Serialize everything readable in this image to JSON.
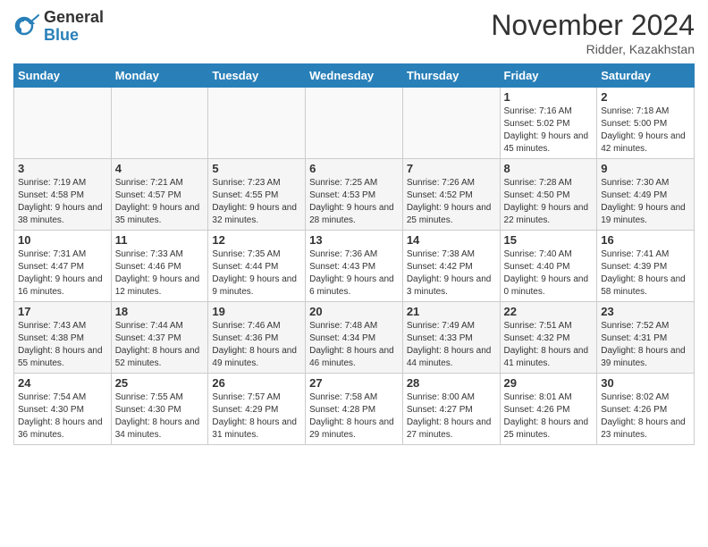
{
  "header": {
    "logo_general": "General",
    "logo_blue": "Blue",
    "title": "November 2024",
    "location": "Ridder, Kazakhstan"
  },
  "days_of_week": [
    "Sunday",
    "Monday",
    "Tuesday",
    "Wednesday",
    "Thursday",
    "Friday",
    "Saturday"
  ],
  "weeks": [
    {
      "days": [
        {
          "num": "",
          "info": ""
        },
        {
          "num": "",
          "info": ""
        },
        {
          "num": "",
          "info": ""
        },
        {
          "num": "",
          "info": ""
        },
        {
          "num": "",
          "info": ""
        },
        {
          "num": "1",
          "info": "Sunrise: 7:16 AM\nSunset: 5:02 PM\nDaylight: 9 hours and 45 minutes."
        },
        {
          "num": "2",
          "info": "Sunrise: 7:18 AM\nSunset: 5:00 PM\nDaylight: 9 hours and 42 minutes."
        }
      ]
    },
    {
      "days": [
        {
          "num": "3",
          "info": "Sunrise: 7:19 AM\nSunset: 4:58 PM\nDaylight: 9 hours and 38 minutes."
        },
        {
          "num": "4",
          "info": "Sunrise: 7:21 AM\nSunset: 4:57 PM\nDaylight: 9 hours and 35 minutes."
        },
        {
          "num": "5",
          "info": "Sunrise: 7:23 AM\nSunset: 4:55 PM\nDaylight: 9 hours and 32 minutes."
        },
        {
          "num": "6",
          "info": "Sunrise: 7:25 AM\nSunset: 4:53 PM\nDaylight: 9 hours and 28 minutes."
        },
        {
          "num": "7",
          "info": "Sunrise: 7:26 AM\nSunset: 4:52 PM\nDaylight: 9 hours and 25 minutes."
        },
        {
          "num": "8",
          "info": "Sunrise: 7:28 AM\nSunset: 4:50 PM\nDaylight: 9 hours and 22 minutes."
        },
        {
          "num": "9",
          "info": "Sunrise: 7:30 AM\nSunset: 4:49 PM\nDaylight: 9 hours and 19 minutes."
        }
      ]
    },
    {
      "days": [
        {
          "num": "10",
          "info": "Sunrise: 7:31 AM\nSunset: 4:47 PM\nDaylight: 9 hours and 16 minutes."
        },
        {
          "num": "11",
          "info": "Sunrise: 7:33 AM\nSunset: 4:46 PM\nDaylight: 9 hours and 12 minutes."
        },
        {
          "num": "12",
          "info": "Sunrise: 7:35 AM\nSunset: 4:44 PM\nDaylight: 9 hours and 9 minutes."
        },
        {
          "num": "13",
          "info": "Sunrise: 7:36 AM\nSunset: 4:43 PM\nDaylight: 9 hours and 6 minutes."
        },
        {
          "num": "14",
          "info": "Sunrise: 7:38 AM\nSunset: 4:42 PM\nDaylight: 9 hours and 3 minutes."
        },
        {
          "num": "15",
          "info": "Sunrise: 7:40 AM\nSunset: 4:40 PM\nDaylight: 9 hours and 0 minutes."
        },
        {
          "num": "16",
          "info": "Sunrise: 7:41 AM\nSunset: 4:39 PM\nDaylight: 8 hours and 58 minutes."
        }
      ]
    },
    {
      "days": [
        {
          "num": "17",
          "info": "Sunrise: 7:43 AM\nSunset: 4:38 PM\nDaylight: 8 hours and 55 minutes."
        },
        {
          "num": "18",
          "info": "Sunrise: 7:44 AM\nSunset: 4:37 PM\nDaylight: 8 hours and 52 minutes."
        },
        {
          "num": "19",
          "info": "Sunrise: 7:46 AM\nSunset: 4:36 PM\nDaylight: 8 hours and 49 minutes."
        },
        {
          "num": "20",
          "info": "Sunrise: 7:48 AM\nSunset: 4:34 PM\nDaylight: 8 hours and 46 minutes."
        },
        {
          "num": "21",
          "info": "Sunrise: 7:49 AM\nSunset: 4:33 PM\nDaylight: 8 hours and 44 minutes."
        },
        {
          "num": "22",
          "info": "Sunrise: 7:51 AM\nSunset: 4:32 PM\nDaylight: 8 hours and 41 minutes."
        },
        {
          "num": "23",
          "info": "Sunrise: 7:52 AM\nSunset: 4:31 PM\nDaylight: 8 hours and 39 minutes."
        }
      ]
    },
    {
      "days": [
        {
          "num": "24",
          "info": "Sunrise: 7:54 AM\nSunset: 4:30 PM\nDaylight: 8 hours and 36 minutes."
        },
        {
          "num": "25",
          "info": "Sunrise: 7:55 AM\nSunset: 4:30 PM\nDaylight: 8 hours and 34 minutes."
        },
        {
          "num": "26",
          "info": "Sunrise: 7:57 AM\nSunset: 4:29 PM\nDaylight: 8 hours and 31 minutes."
        },
        {
          "num": "27",
          "info": "Sunrise: 7:58 AM\nSunset: 4:28 PM\nDaylight: 8 hours and 29 minutes."
        },
        {
          "num": "28",
          "info": "Sunrise: 8:00 AM\nSunset: 4:27 PM\nDaylight: 8 hours and 27 minutes."
        },
        {
          "num": "29",
          "info": "Sunrise: 8:01 AM\nSunset: 4:26 PM\nDaylight: 8 hours and 25 minutes."
        },
        {
          "num": "30",
          "info": "Sunrise: 8:02 AM\nSunset: 4:26 PM\nDaylight: 8 hours and 23 minutes."
        }
      ]
    }
  ]
}
